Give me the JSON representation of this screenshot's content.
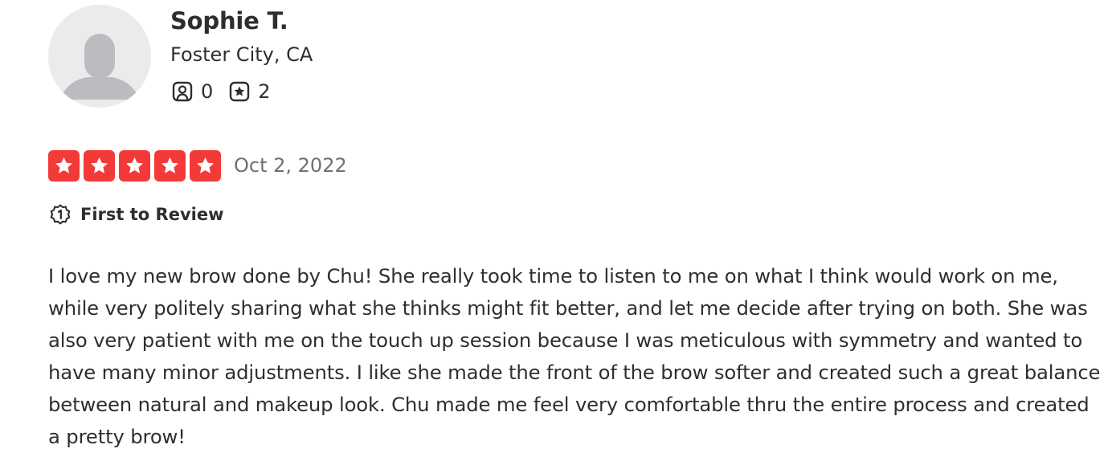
{
  "reviewer": {
    "name": "Sophie T.",
    "location": "Foster City, CA",
    "friends_count": "0",
    "reviews_count": "2",
    "avatar_icon": "default-user-avatar-icon"
  },
  "rating": {
    "stars": 5,
    "max_stars": 5,
    "star_color": "#f43939",
    "date": "Oct 2, 2022"
  },
  "badge": {
    "icon": "first-to-review-icon",
    "label": "First to Review"
  },
  "review": {
    "text": "I love my new brow done by Chu! She really took time to listen to me on what I think would work on me, while very politely sharing what she thinks might fit better, and let me decide after trying on both. She was also very patient with me on the touch up session because I was meticulous with symmetry and wanted to have many minor adjustments. I like she made the front of the brow softer and created such a great balance between natural and makeup look. Chu made me feel very comfortable thru the entire process and created a pretty brow!"
  }
}
